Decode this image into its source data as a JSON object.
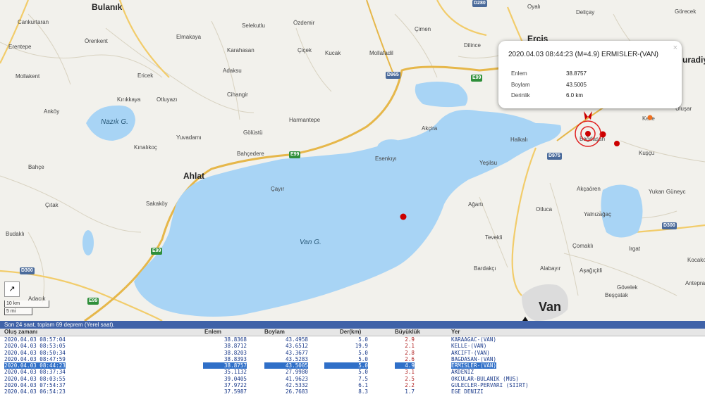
{
  "map": {
    "labels": {
      "bulanik": "Bulanık",
      "cankurtaran": "Cankurtaran",
      "erentepe": "Erentepe",
      "orenkent": "Örenkent",
      "mollakent": "Mollakent",
      "elmakaya": "Elmakaya",
      "selekutlu": "Selekutlu",
      "ozdemir": "Özdemir",
      "cimen": "Çimen",
      "oyali": "Oyalı",
      "delicay": "Deliçay",
      "gorecek": "Görecek",
      "karahasan": "Karahasan",
      "cicek": "Çiçek",
      "kucak": "Kucak",
      "mollafadil": "Mollafadil",
      "dilince": "Dilince",
      "ercis": "Erciş",
      "muradiye": "uradiy",
      "ericek": "Ericek",
      "adaksu": "Adaksu",
      "kirikkaya": "Kırıkkaya",
      "otluyazi": "Otluyazı",
      "cihangir": "Cihangir",
      "ankoy": "Anköy",
      "harmantepe": "Harmantepe",
      "nazik_lake": "Nazık G.",
      "akcira": "Akçira",
      "kelle": "Kelle",
      "ulusar": "Uluşar",
      "yuvadami": "Yuvadamı",
      "golustu": "Gölüstü",
      "halkali": "Halkalı",
      "kuscu": "Kuşçu",
      "kinalikoc": "Kınalıkoç",
      "bahcedere": "Bahçedere",
      "esenkiyi": "Esenkıyı",
      "yesilsu": "Yeşilsu",
      "bahce": "Bahçe",
      "ahlat": "Ahlat",
      "cayir": "Çayır",
      "akcaoren": "Akçaören",
      "yukari_guney": "Yukarı Güneyc",
      "citak": "Çıtak",
      "sakakoy": "Sakaköy",
      "agarti": "Ağartı",
      "otluca": "Otluca",
      "yalnizagac": "Yalnızağaç",
      "budakli": "Budaklı",
      "tevekli": "Tevekli",
      "van_lake": "Van G.",
      "comakli": "Çomaklı",
      "irgat": "Irgat",
      "alabayir": "Alabayır",
      "asagicitli": "Aşağıçitli",
      "kocakoy": "Kocakoy",
      "bardakci": "Bardakçı",
      "govelek": "Gövelek",
      "antepra": "Antepra",
      "bescatak": "Beşçatak",
      "adacik": "Adacık",
      "van": "Van",
      "bagdasan": "Bağdaşan"
    },
    "roads": {
      "d280": "D280",
      "d965": "D965",
      "e99_a": "E99",
      "e99_b": "E99",
      "e99_c": "E99",
      "e99_d": "E99",
      "d975": "D975",
      "d300_a": "D300",
      "d300_b": "D300"
    },
    "scale": {
      "km": "10 km",
      "mi": "5 mi"
    },
    "expand_icon": "↗",
    "colors": {
      "lake": "#a8d4f5",
      "quake": "#cc0000",
      "recent_quake": "#f07020",
      "land": "#f2f1ec"
    }
  },
  "popup": {
    "title": "2020.04.03 08:44:23 (M=4.9) ERMISLER-(VAN)",
    "close": "×",
    "rows": [
      {
        "label": "Enlem",
        "value": "38.8757"
      },
      {
        "label": "Boylam",
        "value": "43.5005"
      },
      {
        "label": "Derinlik",
        "value": "6.0 km"
      }
    ]
  },
  "panel": {
    "header": "Son 24 saat, toplam 69 deprem (Yerel saat).",
    "columns": {
      "time": "Oluş zamanı",
      "lat": "Enlem",
      "lon": "Boylam",
      "depth": "Der(km)",
      "mag": "Büyüklük",
      "loc": "Yer"
    },
    "rows": [
      {
        "time": "2020.04.03 08:57:04",
        "lat": "38.8368",
        "lon": "43.4958",
        "depth": "5.0",
        "mag": "2.9",
        "loc": "KARAAGAC-(VAN)"
      },
      {
        "time": "2020.04.03 08:53:05",
        "lat": "38.8712",
        "lon": "43.6512",
        "depth": "19.9",
        "mag": "2.1",
        "loc": "KELLE-(VAN)"
      },
      {
        "time": "2020.04.03 08:50:34",
        "lat": "38.8203",
        "lon": "43.3677",
        "depth": "5.0",
        "mag": "2.8",
        "loc": "AKCIFT-(VAN)"
      },
      {
        "time": "2020.04.03 08:47:59",
        "lat": "38.8393",
        "lon": "43.5283",
        "depth": "5.0",
        "mag": "2.6",
        "loc": "BAGDASAN-(VAN)"
      },
      {
        "time": "2020.04.03 08:44:23",
        "lat": "38.8757",
        "lon": "43.5005",
        "depth": "5.0",
        "mag": "4.9",
        "loc": "ERMISLER-(VAN)",
        "selected": true
      },
      {
        "time": "2020.04.03 08:37:34",
        "lat": "35.1132",
        "lon": "27.9980",
        "depth": "5.0",
        "mag": "3.1",
        "loc": "AKDENIZ"
      },
      {
        "time": "2020.04.03 08:03:55",
        "lat": "39.0405",
        "lon": "41.9623",
        "depth": "7.5",
        "mag": "2.5",
        "loc": "OKCULAR-BULANIK (MUS)"
      },
      {
        "time": "2020.04.03 07:54:37",
        "lat": "37.9722",
        "lon": "42.5332",
        "depth": "6.1",
        "mag": "2.2",
        "loc": "GULECLER-PERVARI (SIIRT)"
      },
      {
        "time": "2020.04.03 06:54:23",
        "lat": "37.5987",
        "lon": "26.7683",
        "depth": "8.3",
        "mag": "1.7",
        "loc": "EGE DENIZI"
      }
    ]
  }
}
